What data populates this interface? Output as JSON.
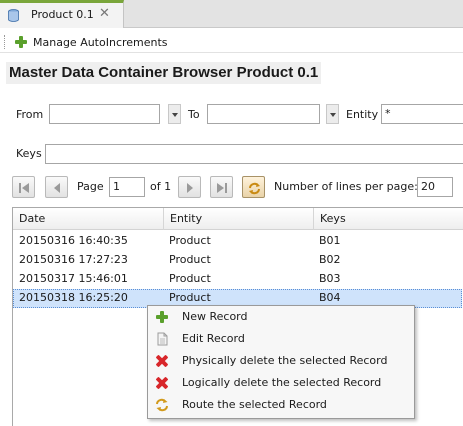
{
  "tab": {
    "title": "Product 0.1",
    "close": "✕"
  },
  "toolbar": {
    "manage_label": "Manage AutoIncrements"
  },
  "page_title": "Master Data Container Browser Product 0.1",
  "search": {
    "from_label": "From",
    "from_value": "",
    "to_label": "To",
    "to_value": "",
    "entity_label": "Entity",
    "entity_value": "*",
    "keys_label": "Keys",
    "keys_value": ""
  },
  "pager": {
    "page_label": "Page",
    "page_value": "1",
    "of_label": "of 1",
    "lines_label": "Number of lines per page:",
    "lines_value": "20"
  },
  "table": {
    "columns": [
      "Date",
      "Entity",
      "Keys"
    ],
    "rows": [
      [
        "20150316 16:40:35",
        "Product",
        "B01"
      ],
      [
        "20150316 17:27:23",
        "Product",
        "B02"
      ],
      [
        "20150317 15:46:01",
        "Product",
        "B03"
      ],
      [
        "20150318 16:25:20",
        "Product",
        "B04"
      ]
    ]
  },
  "context_menu": {
    "items": [
      {
        "label": "New Record",
        "icon": "plus-icon"
      },
      {
        "label": "Edit Record",
        "icon": "document-icon"
      },
      {
        "label": "Physically delete the selected Record",
        "icon": "delete-icon"
      },
      {
        "label": "Logically delete the selected Record",
        "icon": "delete-icon"
      },
      {
        "label": "Route the selected Record",
        "icon": "route-icon"
      }
    ]
  },
  "colors": {
    "tab_accent": "#7aa63b",
    "selection": "#cfe3fb",
    "plus_green": "#5aa02c",
    "delete_red": "#d8262a"
  }
}
